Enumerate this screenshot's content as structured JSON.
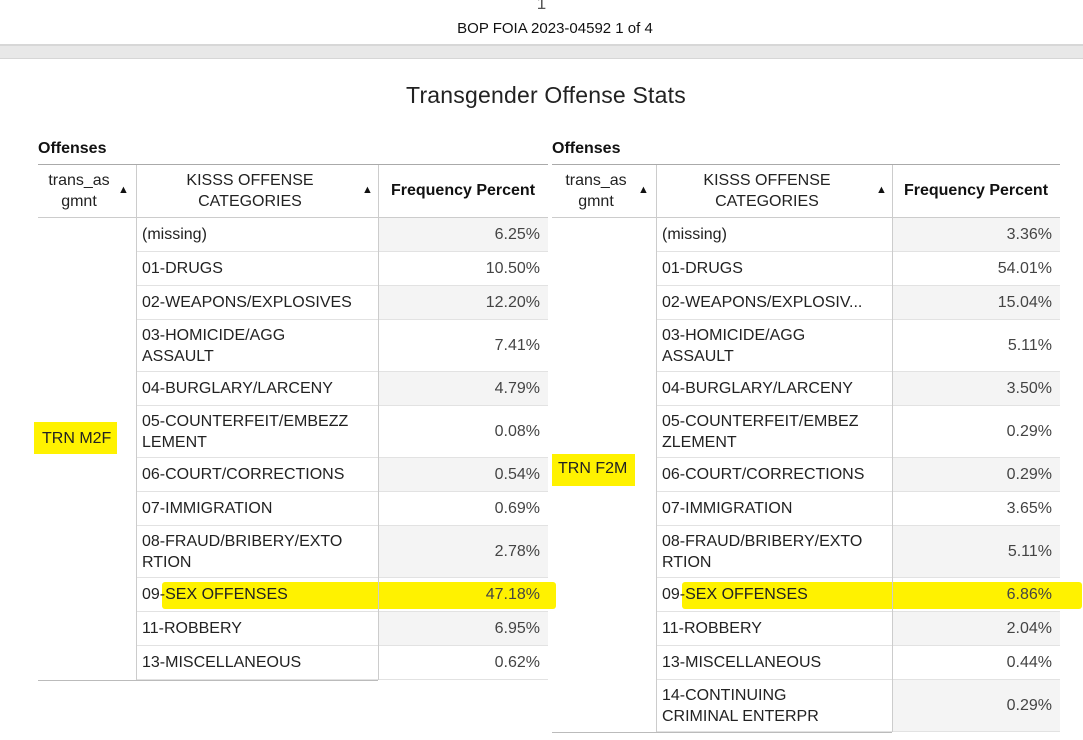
{
  "viewer": {
    "page_number": "1",
    "document_id": "BOP FOIA 2023-04592 1 of 4"
  },
  "report": {
    "title": "Transgender Offense Stats"
  },
  "colors": {
    "highlight": "#fff200",
    "value_column_bg": "#f4f4f4",
    "grid_line": "#e2e2e2"
  },
  "tables": [
    {
      "section_label": "Offenses",
      "headers": {
        "group": "trans_as\ngmnt",
        "category": "KISSS OFFENSE\nCATEGORIES",
        "value": "Frequency Percent",
        "sort_icon": "▲"
      },
      "group_value": "TRN M2F",
      "rows": [
        {
          "category": "(missing)",
          "value": "6.25%"
        },
        {
          "category": "01-DRUGS",
          "value": "10.50%"
        },
        {
          "category": "02-WEAPONS/EXPLOSIVES",
          "value": "12.20%"
        },
        {
          "category": "03-HOMICIDE/AGG\nASSAULT",
          "value": "7.41%"
        },
        {
          "category": "04-BURGLARY/LARCENY",
          "value": "4.79%"
        },
        {
          "category": "05-COUNTERFEIT/EMBEZZ\nLEMENT",
          "value": "0.08%"
        },
        {
          "category": "06-COURT/CORRECTIONS",
          "value": "0.54%"
        },
        {
          "category": "07-IMMIGRATION",
          "value": "0.69%"
        },
        {
          "category": "08-FRAUD/BRIBERY/EXTO\nRTION",
          "value": "2.78%"
        },
        {
          "category": "09-SEX OFFENSES",
          "value": "47.18%",
          "highlighted": true
        },
        {
          "category": "11-ROBBERY",
          "value": "6.95%"
        },
        {
          "category": "13-MISCELLANEOUS",
          "value": "0.62%"
        }
      ]
    },
    {
      "section_label": "Offenses",
      "headers": {
        "group": "trans_as\ngmnt",
        "category": "KISSS OFFENSE\nCATEGORIES",
        "value": "Frequency Percent",
        "sort_icon": "▲"
      },
      "group_value": "TRN F2M",
      "rows": [
        {
          "category": "(missing)",
          "value": "3.36%"
        },
        {
          "category": "01-DRUGS",
          "value": "54.01%"
        },
        {
          "category": "02-WEAPONS/EXPLOSIV...",
          "value": "15.04%"
        },
        {
          "category": "03-HOMICIDE/AGG\nASSAULT",
          "value": "5.11%"
        },
        {
          "category": "04-BURGLARY/LARCENY",
          "value": "3.50%"
        },
        {
          "category": "05-COUNTERFEIT/EMBEZ\nZLEMENT",
          "value": "0.29%"
        },
        {
          "category": "06-COURT/CORRECTIONS",
          "value": "0.29%"
        },
        {
          "category": "07-IMMIGRATION",
          "value": "3.65%"
        },
        {
          "category": "08-FRAUD/BRIBERY/EXTO\nRTION",
          "value": "5.11%"
        },
        {
          "category": "09-SEX OFFENSES",
          "value": "6.86%",
          "highlighted": true
        },
        {
          "category": "11-ROBBERY",
          "value": "2.04%"
        },
        {
          "category": "13-MISCELLANEOUS",
          "value": "0.44%"
        },
        {
          "category": "14-CONTINUING\nCRIMINAL ENTERPR",
          "value": "0.29%"
        }
      ]
    }
  ]
}
